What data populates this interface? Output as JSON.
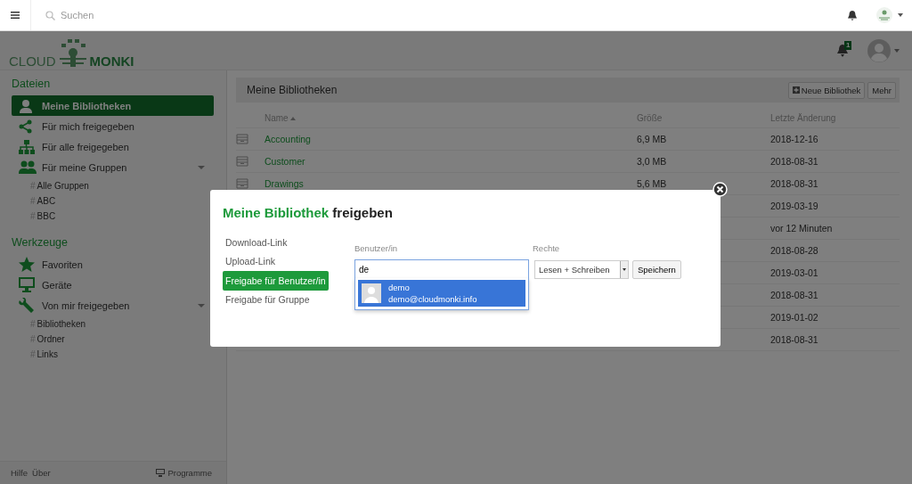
{
  "topbar": {
    "search_placeholder": "Suchen"
  },
  "logo": {
    "left": "CLOUD",
    "right": "MONKI"
  },
  "notifications": {
    "count": "1"
  },
  "sidebar": {
    "sections": [
      {
        "heading": "Dateien",
        "items": [
          {
            "label": "Meine Bibliotheken",
            "selected": true
          },
          {
            "label": "Für mich freigegeben",
            "selected": false
          },
          {
            "label": "Für alle freigegeben",
            "selected": false
          },
          {
            "label": "Für meine Gruppen",
            "selected": false,
            "children": [
              {
                "hash": "#",
                "label": "Alle Gruppen"
              },
              {
                "hash": "#",
                "label": "ABC"
              },
              {
                "hash": "#",
                "label": "BBC"
              }
            ]
          }
        ]
      },
      {
        "heading": "Werkzeuge",
        "items": [
          {
            "label": "Favoriten",
            "selected": false
          },
          {
            "label": "Geräte",
            "selected": false
          },
          {
            "label": "Von mir freigegeben",
            "selected": false,
            "children": [
              {
                "hash": "#",
                "label": "Bibliotheken"
              },
              {
                "hash": "#",
                "label": "Ordner"
              },
              {
                "hash": "#",
                "label": "Links"
              }
            ]
          }
        ]
      }
    ],
    "footer_links": [
      "Hilfe",
      "Über"
    ],
    "programs": "Programme"
  },
  "content": {
    "title": "Meine Bibliotheken",
    "buttons": [
      "Neue Bibliothek",
      "Mehr"
    ],
    "columns": [
      {
        "label": "Name",
        "sorted": true
      },
      {
        "label": "Größe",
        "sorted": false
      },
      {
        "label": "Letzte Änderung",
        "sorted": false
      }
    ],
    "rows": [
      {
        "name": "Accounting",
        "size": "6,9 MB",
        "date": "2018-12-16"
      },
      {
        "name": "Customer",
        "size": "3,0 MB",
        "date": "2018-08-31"
      },
      {
        "name": "Drawings",
        "size": "5,6 MB",
        "date": "2018-08-31"
      },
      {
        "date": "2019-03-19"
      },
      {
        "date": "vor 12 Minuten"
      },
      {
        "date": "2018-08-28"
      },
      {
        "date": "2019-03-01"
      },
      {
        "date": "2018-08-31"
      },
      {
        "date": "2019-01-02"
      },
      {
        "date": "2018-08-31"
      }
    ]
  },
  "modal": {
    "title_highlight": "Meine Bibliothek",
    "title_rest": "freigeben",
    "tabs": [
      {
        "label": "Download-Link",
        "selected": false
      },
      {
        "label": "Upload-Link",
        "selected": false
      },
      {
        "label": "Freigabe für Benutzer/in",
        "selected": true
      },
      {
        "label": "Freigabe für Gruppe",
        "selected": false
      }
    ],
    "user_label": "Benutzer/in",
    "rights_label": "Rechte",
    "user_value": "de",
    "permission": "Lesen + Schreiben",
    "save": "Speichern",
    "suggestions": [
      {
        "name": "demo",
        "email": "demo@cloudmonki.info",
        "selected": true
      }
    ]
  }
}
